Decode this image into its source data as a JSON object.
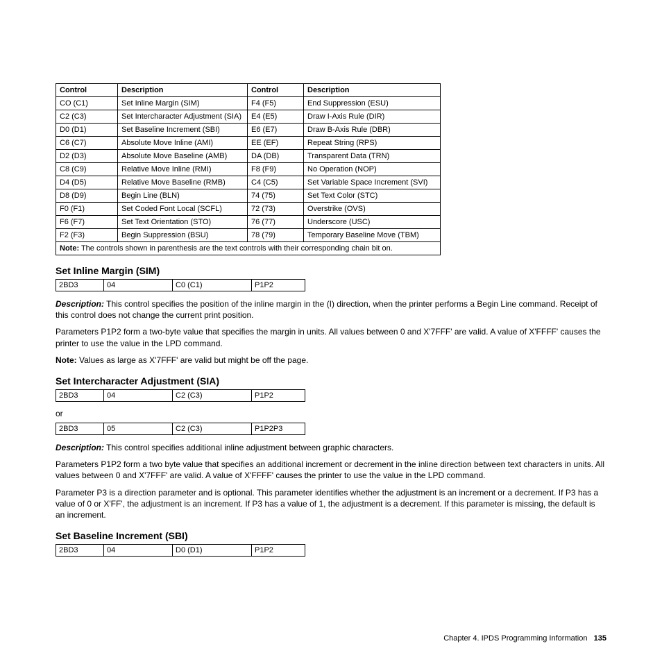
{
  "table_main": {
    "headers": [
      "Control",
      "Description",
      "Control",
      "Description"
    ],
    "rows": [
      [
        "CO (C1)",
        "Set Inline Margin (SIM)",
        "F4 (F5)",
        "End Suppression (ESU)"
      ],
      [
        "C2 (C3)",
        "Set Intercharacter Adjustment (SIA)",
        "E4 (E5)",
        "Draw I-Axis Rule (DIR)"
      ],
      [
        "D0 (D1)",
        "Set Baseline Increment (SBI)",
        "E6 (E7)",
        "Draw B-Axis Rule (DBR)"
      ],
      [
        "C6 (C7)",
        "Absolute Move Inline (AMI)",
        "EE (EF)",
        "Repeat String (RPS)"
      ],
      [
        "D2 (D3)",
        "Absolute Move Baseline (AMB)",
        "DA (DB)",
        "Transparent Data (TRN)"
      ],
      [
        "C8 (C9)",
        "Relative Move Inline (RMI)",
        "F8 (F9)",
        "No Operation (NOP)"
      ],
      [
        "D4 (D5)",
        "Relative Move Baseline (RMB)",
        "C4 (C5)",
        "Set Variable Space Increment (SVI)"
      ],
      [
        "D8 (D9)",
        "Begin Line (BLN)",
        "74 (75)",
        "Set Text Color (STC)"
      ],
      [
        "F0 (F1)",
        "Set Coded Font Local (SCFL)",
        "72 (73)",
        "Overstrike (OVS)"
      ],
      [
        "F6 (F7)",
        "Set Text Orientation (STO)",
        "76 (77)",
        "Underscore (USC)"
      ],
      [
        "F2 (F3)",
        "Begin Suppression (BSU)",
        "78 (79)",
        "Temporary Baseline Move (TBM)"
      ]
    ],
    "note_label": "Note:",
    "note_text": " The controls shown in parenthesis are the text controls with their corresponding chain bit on."
  },
  "sim": {
    "heading": "Set Inline Margin (SIM)",
    "row": [
      "2BD3",
      "04",
      "C0 (C1)",
      "P1P2"
    ],
    "desc_label": "Description:",
    "desc_text": " This control specifies the position of the inline margin in the (I) direction, when the printer performs a Begin Line command. Receipt of this control does not change the current print position.",
    "para2": "Parameters P1P2 form a two-byte value that specifies the margin in units. All values between 0 and X'7FFF' are valid. A value of X'FFFF' causes the printer to use the value in the LPD command.",
    "note_label": "Note:",
    "note_text": " Values as large as X'7FFF' are valid but might be off the page."
  },
  "sia": {
    "heading": "Set Intercharacter Adjustment (SIA)",
    "row1": [
      "2BD3",
      "04",
      "C2 (C3)",
      "P1P2"
    ],
    "or": "or",
    "row2": [
      "2BD3",
      "05",
      "C2 (C3)",
      "P1P2P3"
    ],
    "desc_label": "Description:",
    "desc_text": " This control specifies additional inline adjustment between graphic characters.",
    "para2": "Parameters P1P2 form a two byte value that specifies an additional increment or decrement in the inline direction between text characters in units. All values between 0 and X'7FFF' are valid. A value of X'FFFF' causes the printer to use the value in the LPD command.",
    "para3": "Parameter P3 is a direction parameter and is optional. This parameter identifies whether the adjustment is an increment or a decrement. If P3 has a value of 0 or X'FF', the adjustment is an increment. If P3 has a value of 1, the adjustment is a decrement. If this parameter is missing, the default is an increment."
  },
  "sbi": {
    "heading": "Set Baseline Increment (SBI)",
    "row": [
      "2BD3",
      "04",
      "D0 (D1)",
      "P1P2"
    ]
  },
  "footer": {
    "chapter": "Chapter 4. IPDS Programming Information",
    "page": "135"
  }
}
